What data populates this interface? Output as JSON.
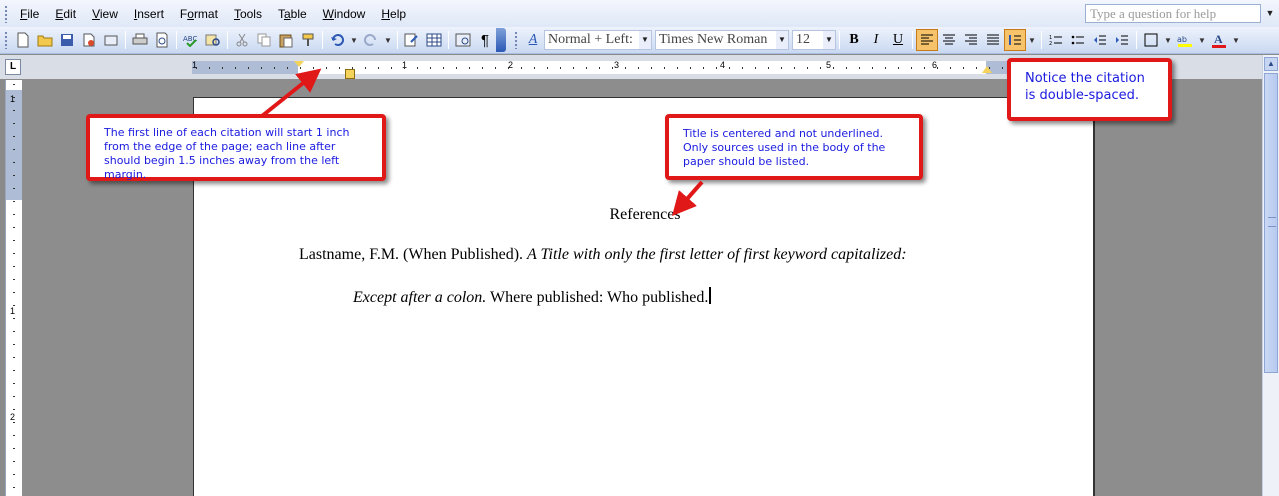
{
  "menu": {
    "items": [
      "File",
      "Edit",
      "View",
      "Insert",
      "Format",
      "Tools",
      "Table",
      "Window",
      "Help"
    ],
    "underline": [
      "F",
      "E",
      "V",
      "I",
      "o",
      "T",
      "a",
      "W",
      "H"
    ],
    "help_placeholder": "Type a question for help"
  },
  "toolbar": {
    "style": "Normal + Left:",
    "font": "Times New Roman",
    "size": "12",
    "bold": "B",
    "italic": "I",
    "underline": "U",
    "pilcrow": "¶",
    "style_icon": "A"
  },
  "ruler": {
    "numbers": [
      "1",
      "1",
      "2",
      "3",
      "4",
      "5",
      "6"
    ],
    "vertical_numbers": [
      "1",
      "1",
      "2"
    ],
    "tab_selector": "L"
  },
  "document": {
    "title": "References",
    "citation": {
      "line1_plain": "Lastname, F.M. (When Published). ",
      "line1_italic": "A Title with only the first letter of first keyword capitalized:",
      "line2_italic": "Except after a colon.",
      "line2_plain": " Where published: Who published."
    }
  },
  "callouts": {
    "indent": "The first line of each citation will start 1 inch from the edge of the page; each line after should begin 1.5 inches away from the left margin.",
    "title": "Title is centered and not underlined. Only sources used in the body of the paper should be listed.",
    "spacing": "Notice the citation is double-spaced."
  },
  "colors": {
    "callout_border": "#e01818",
    "callout_text": "#1a1ae0",
    "ruler_indent": "#f3d35c",
    "toolbar_active": "#f6c36a"
  }
}
